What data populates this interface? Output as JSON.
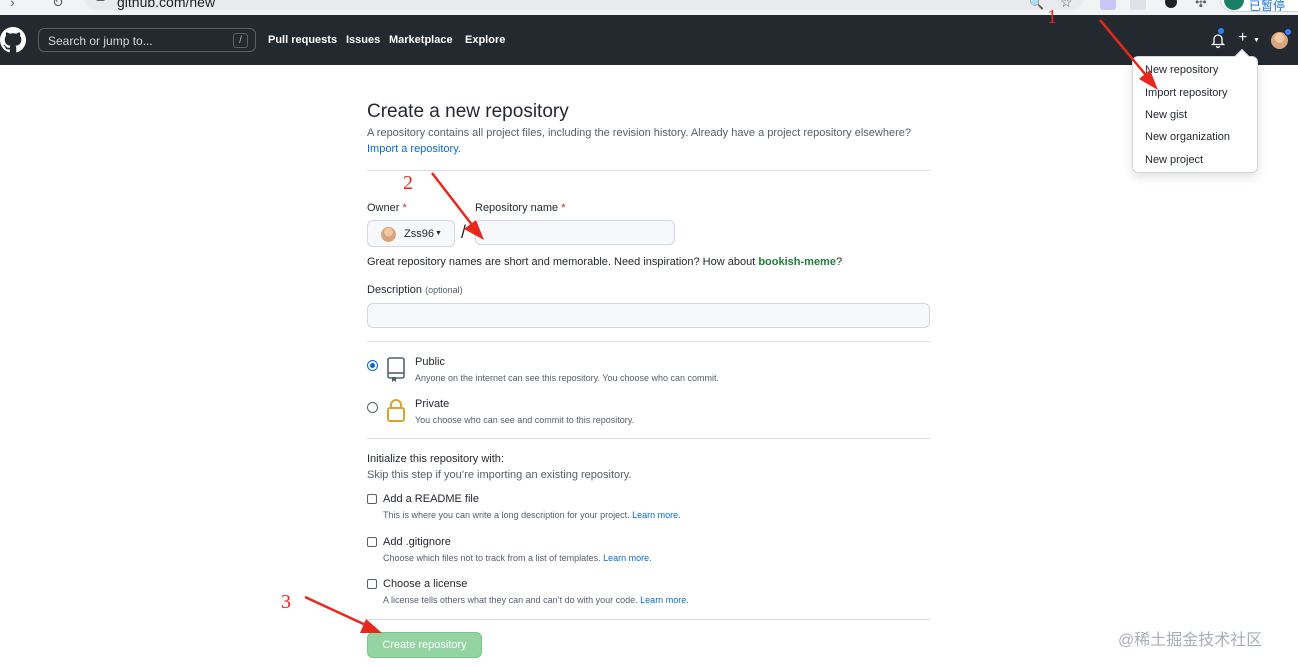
{
  "browser": {
    "url": "github.com/new",
    "profile_name": "已暂停"
  },
  "header": {
    "search_placeholder": "Search or jump to...",
    "search_shortcut": "/",
    "nav": [
      "Pull requests",
      "Issues",
      "Marketplace",
      "Explore"
    ]
  },
  "create_menu": {
    "items": [
      "New repository",
      "Import repository",
      "New gist",
      "New organization",
      "New project"
    ]
  },
  "form": {
    "title": "Create a new repository",
    "subtitle": "A repository contains all project files, including the revision history. Already have a project repository elsewhere?",
    "import_link": "Import a repository.",
    "owner_label": "Owner",
    "repo_name_label": "Repository name",
    "required_mark": "*",
    "owner_value": "Zss96",
    "separator": "/",
    "repo_name_value": "",
    "name_hint": "Great repository names are short and memorable. Need inspiration? How about",
    "name_suggestion": "bookish-meme",
    "name_hint_end": "?",
    "description_label": "Description",
    "description_optional": "(optional)",
    "description_value": "",
    "visibility": {
      "selected": "Public",
      "public_title": "Public",
      "public_desc": "Anyone on the internet can see this repository. You choose who can commit.",
      "private_title": "Private",
      "private_desc": "You choose who can see and commit to this repository."
    },
    "init": {
      "heading": "Initialize this repository with:",
      "subheading": "Skip this step if you’re importing an existing repository.",
      "readme_title": "Add a README file",
      "readme_desc": "This is where you can write a long description for your project.",
      "gitignore_title": "Add .gitignore",
      "gitignore_desc": "Choose which files not to track from a list of templates.",
      "license_title": "Choose a license",
      "license_desc": "A license tells others what they can and can’t do with your code.",
      "learn_more": "Learn more."
    },
    "submit_label": "Create repository"
  },
  "annotations": {
    "step1": "1",
    "step2": "2",
    "step3": "3",
    "arrow_color": "#e8281c"
  },
  "watermark": "@稀土掘金技术社区"
}
